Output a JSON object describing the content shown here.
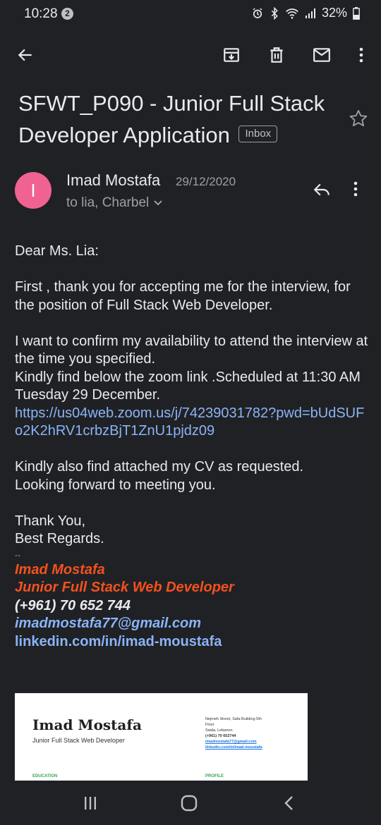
{
  "status": {
    "time": "10:28",
    "notification_count": "2",
    "battery": "32%"
  },
  "email": {
    "subject": "SFWT_P090 - Junior Full Stack Developer Application",
    "label": "Inbox",
    "sender_initial": "I",
    "sender_name": "Imad Mostafa",
    "date": "29/12/2020",
    "recipients": "to lia, Charbel",
    "avatar_color": "#f06292"
  },
  "body": {
    "greeting": "Dear Ms. Lia:",
    "para1": "First , thank you for accepting me for the interview, for the position of Full Stack Web Developer.",
    "para2_line1": "I want to confirm my availability  to attend the interview at the time you specified.",
    "para2_line2": "Kindly find below the zoom link .Scheduled at 11:30 AM Tuesday 29 December.",
    "zoom_link": "https://us04web.zoom.us/j/74239031782?pwd=bUdSUFo2K2hRV1crbzBjT1ZnU1pjdz09",
    "para3_line1": "Kindly also find attached my CV as requested.",
    "para3_line2": "Looking forward to meeting you.",
    "closing1": "Thank You,",
    "closing2": "Best Regards."
  },
  "signature": {
    "separator": "--",
    "name": "Imad Mostafa",
    "title": "Junior Full Stack Web Developer",
    "phone": "(+961) 70 652 744",
    "email": "imadmostafa77@gmail.com",
    "linkedin": "linkedin.com/in/imad-moustafa",
    "accent_color": "#f4511e",
    "link_color": "#8ab4f8"
  },
  "attachment": {
    "cv_name": "Imad Mostafa",
    "cv_title": "Junior Full Stack Web Developer",
    "address_line1": "Nejmeh Street, Safa Building 5th",
    "address_line2": "Floor",
    "address_line3": "Saida, Lebanon",
    "phone": "(+961) 70  652744",
    "email": "imadmostafa77@gmail.com",
    "linkedin": "linkedin.com/in/imad-moustafa",
    "section_education": "EDUCATION",
    "section_profile": "PROFILE"
  },
  "icons": {
    "back": "arrow-back-icon",
    "archive": "archive-icon",
    "delete": "trash-icon",
    "mark_unread": "mail-icon",
    "more": "more-vert-icon",
    "star": "star-icon",
    "reply": "reply-icon",
    "nav_recents": "recents-icon",
    "nav_home": "home-icon",
    "nav_back": "nav-back-icon"
  }
}
